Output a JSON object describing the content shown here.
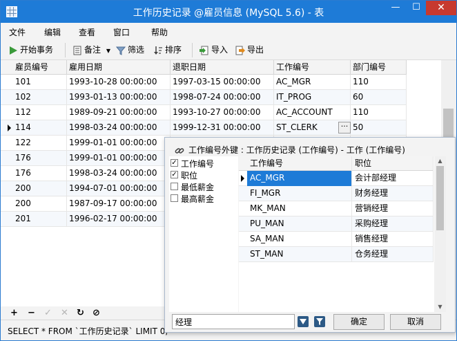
{
  "window": {
    "title": "工作历史记录 @雇员信息 (MySQL 5.6) - 表",
    "min": "—",
    "max": "☐",
    "close": "✕"
  },
  "menu": [
    "文件",
    "编辑",
    "查看",
    "窗口",
    "帮助"
  ],
  "toolbar": {
    "begin_transaction": "开始事务",
    "memo": "备注",
    "filter": "筛选",
    "sort": "排序",
    "import": "导入",
    "export": "导出"
  },
  "grid": {
    "columns": [
      "雇员编号",
      "雇用日期",
      "退职日期",
      "工作编号",
      "部门编号"
    ],
    "rows": [
      [
        "101",
        "1993-10-28 00:00:00",
        "1997-03-15 00:00:00",
        "AC_MGR",
        "110"
      ],
      [
        "102",
        "1993-01-13 00:00:00",
        "1998-07-24 00:00:00",
        "IT_PROG",
        "60"
      ],
      [
        "112",
        "1989-09-21 00:00:00",
        "1993-10-27 00:00:00",
        "AC_ACCOUNT",
        "110"
      ],
      [
        "114",
        "1998-03-24 00:00:00",
        "1999-12-31 00:00:00",
        "ST_CLERK",
        "50"
      ],
      [
        "122",
        "1999-01-01 00:00:00",
        "",
        "",
        ""
      ],
      [
        "176",
        "1999-01-01 00:00:00",
        "",
        "",
        ""
      ],
      [
        "176",
        "1998-03-24 00:00:00",
        "",
        "",
        ""
      ],
      [
        "200",
        "1994-07-01 00:00:00",
        "",
        "",
        ""
      ],
      [
        "200",
        "1987-09-17 00:00:00",
        "",
        "",
        ""
      ],
      [
        "201",
        "1996-02-17 00:00:00",
        "",
        "",
        ""
      ]
    ],
    "current_row": 3,
    "ellipsis": "···"
  },
  "footer_buttons": [
    "+",
    "−",
    "✓",
    "✕",
    "↻",
    "⊘"
  ],
  "status": {
    "sql": "SELECT * FROM `工作历史记录` LIMIT 0,"
  },
  "popup": {
    "title": "工作编号外键 : 工作历史记录 (工作编号) - 工作 (工作编号)",
    "fields": [
      {
        "label": "工作编号",
        "checked": true
      },
      {
        "label": "职位",
        "checked": true
      },
      {
        "label": "最低薪金",
        "checked": false
      },
      {
        "label": "最高薪金",
        "checked": false
      }
    ],
    "columns": [
      "工作编号",
      "职位"
    ],
    "rows": [
      [
        "AC_MGR",
        "会计部经理"
      ],
      [
        "FI_MGR",
        "财务经理"
      ],
      [
        "MK_MAN",
        "营销经理"
      ],
      [
        "PU_MAN",
        "采购经理"
      ],
      [
        "SA_MAN",
        "销售经理"
      ],
      [
        "ST_MAN",
        "仓务经理"
      ]
    ],
    "selected_row": 0,
    "search_value": "经理",
    "ok": "确定",
    "cancel": "取消"
  },
  "colors": {
    "titlebar": "#1e7bd7",
    "selection": "#1e7bd7",
    "close": "#c7392f"
  }
}
